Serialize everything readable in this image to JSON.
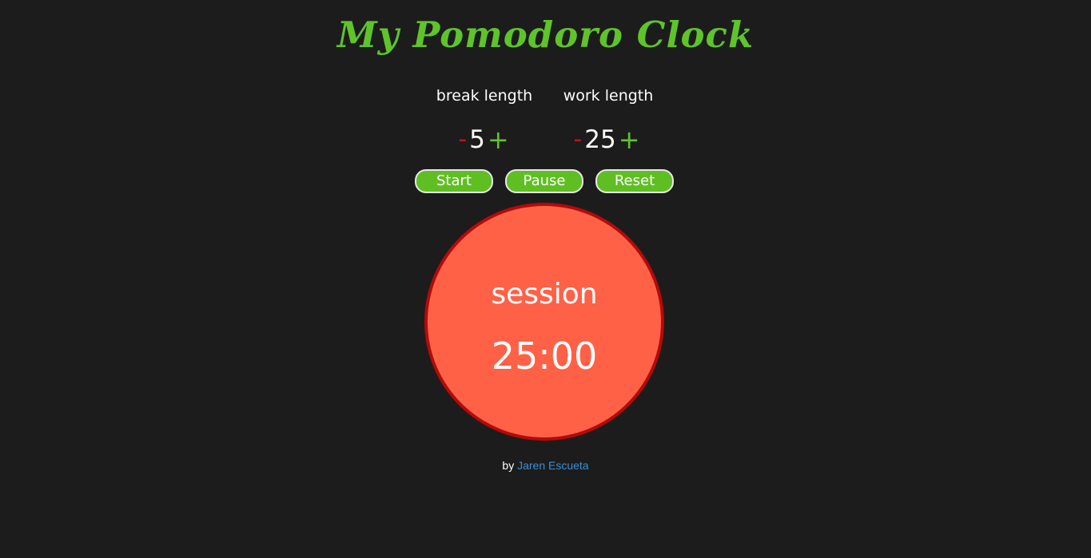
{
  "app": {
    "title": "My Pomodoro Clock"
  },
  "settings": {
    "break": {
      "label": "break length",
      "decrement": "-",
      "value": "5",
      "increment": "+"
    },
    "work": {
      "label": "work length",
      "decrement": "-",
      "value": "25",
      "increment": "+"
    }
  },
  "controls": {
    "start_label": "Start",
    "pause_label": "Pause",
    "reset_label": "Reset"
  },
  "timer": {
    "mode": "session",
    "display": "25:00"
  },
  "footer": {
    "prefix": "by",
    "author": "Jaren Escueta"
  },
  "colors": {
    "background": "#1c1c1c",
    "accent_green": "#5ec42a",
    "decrement_red": "#c0141a",
    "timer_fill": "#ff6147",
    "timer_border": "#b40a0a",
    "link_blue": "#3a8fd6"
  }
}
